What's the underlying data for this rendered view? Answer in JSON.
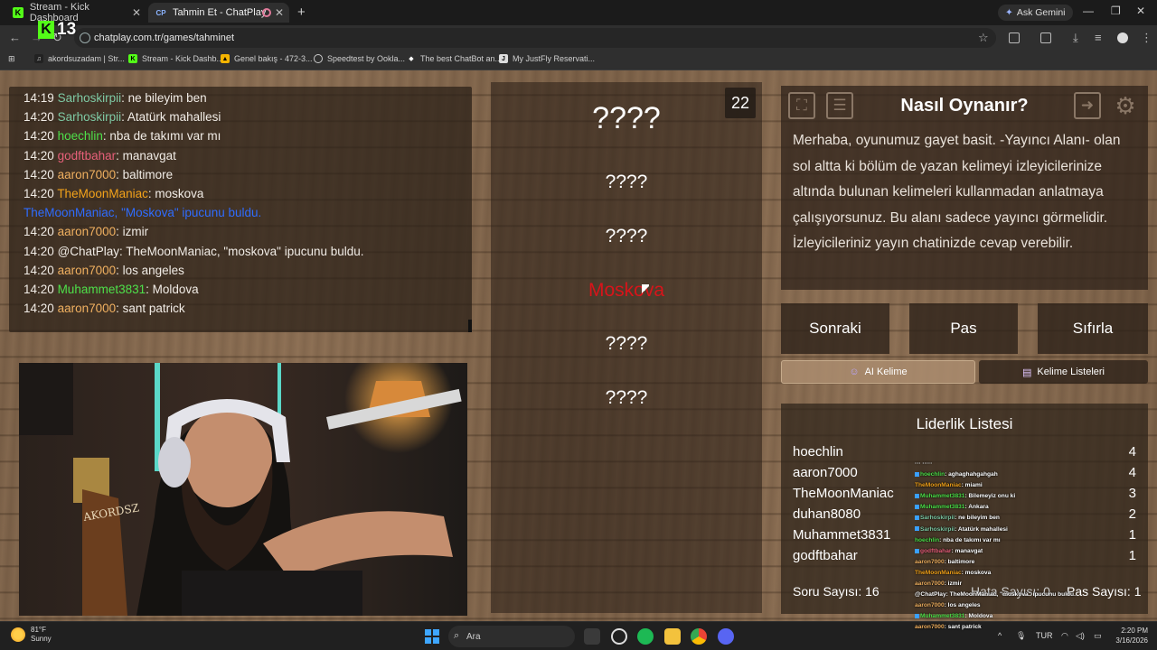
{
  "browser": {
    "tabs": [
      {
        "label": "Stream - Kick Dashboard",
        "active": false
      },
      {
        "label": "Tahmin Et - ChatPlay",
        "active": true
      }
    ],
    "ask_gemini": "Ask Gemini",
    "url": "chatplay.com.tr/games/tahminet",
    "bookmarks": [
      "akordsuzadam | Str...",
      "Stream - Kick Dashb...",
      "Genel bakış - 472-3...",
      "Speedtest by Ookla...",
      "The best ChatBot an...",
      "My JustFly Reservati..."
    ],
    "kick_badge": "13"
  },
  "chat": [
    {
      "time": "14:19",
      "user": "Sarhoskirpii",
      "color": "#7ec9a4",
      "msg": ": ne bileyim ben"
    },
    {
      "time": "14:20",
      "user": "Sarhoskirpii",
      "color": "#7ec9a4",
      "msg": ": Atatürk mahallesi"
    },
    {
      "time": "14:20",
      "user": "hoechlin",
      "color": "#4ee04a",
      "msg": ": nba de takımı var mı"
    },
    {
      "time": "14:20",
      "user": "godftbahar",
      "color": "#e7607a",
      "msg": ": manavgat"
    },
    {
      "time": "14:20",
      "user": "aaron7000",
      "color": "#f0b060",
      "msg": ": baltimore"
    },
    {
      "time": "14:20",
      "user": "TheMoonManiac",
      "color": "#f2a21a",
      "msg": ": moskova"
    },
    {
      "time": "",
      "user": "TheMoonManiac,",
      "color": "#2f6cff",
      "msg": " \"Moskova\" ipucunu buldu.",
      "system": true
    },
    {
      "time": "14:20",
      "user": "aaron7000",
      "color": "#f0b060",
      "msg": ": izmir"
    },
    {
      "time": "14:20",
      "user": "@ChatPlay",
      "color": "#f1ece6",
      "msg": ": TheMoonManiac, \"moskova\" ipucunu buldu."
    },
    {
      "time": "14:20",
      "user": "aaron7000",
      "color": "#f0b060",
      "msg": ": los angeles"
    },
    {
      "time": "14:20",
      "user": "Muhammet3831",
      "color": "#4ee04a",
      "msg": ": Moldova"
    },
    {
      "time": "14:20",
      "user": "aaron7000",
      "color": "#f0b060",
      "msg": ": sant patrick"
    }
  ],
  "game": {
    "counter": "22",
    "words": [
      {
        "text": "????",
        "revealed": false
      },
      {
        "text": "????",
        "revealed": false
      },
      {
        "text": "????",
        "revealed": false
      },
      {
        "text": "Moskova",
        "revealed": true
      },
      {
        "text": "????",
        "revealed": false
      },
      {
        "text": "????",
        "revealed": false
      }
    ]
  },
  "howto": {
    "title": "Nasıl Oynanır?",
    "text": "Merhaba, oyunumuz gayet basit. -Yayıncı Alanı- olan sol altta ki bölüm de yazan kelimeyi izleyicilerinize altında bulunan kelimeleri kullanmadan anlatmaya çalışıyorsunuz. Bu alanı sadece yayıncı görmelidir. İzleyicileriniz yayın chatinizde cevap verebilir."
  },
  "controls": {
    "next": "Sonraki",
    "pass": "Pas",
    "reset": "Sıfırla",
    "ai_word": "AI Kelime",
    "word_lists": "Kelime Listeleri"
  },
  "leaderboard": {
    "title": "Liderlik Listesi",
    "rows": [
      {
        "name": "hoechlin",
        "score": "4"
      },
      {
        "name": "aaron7000",
        "score": "4"
      },
      {
        "name": "TheMoonManiac",
        "score": "3"
      },
      {
        "name": "duhan8080",
        "score": "2"
      },
      {
        "name": "Muhammet3831",
        "score": "1"
      },
      {
        "name": "godftbahar",
        "score": "1"
      }
    ],
    "question_count": "Soru Sayısı: 16",
    "error_count": "Hata Sayısı: 0",
    "pass_count": "Pas Sayısı: 1"
  },
  "stream_overlay": [
    {
      "user": "",
      "msg": "··· ·····",
      "color": "#f0b060"
    },
    {
      "user": "hoechlin",
      "msg": ": aghaghahgahgah",
      "color": "#4ee04a",
      "badge": true
    },
    {
      "user": "TheMoonManiac",
      "msg": ": miami",
      "color": "#f2a21a"
    },
    {
      "user": "Muhammet3831",
      "msg": ": Bilemeyiz onu ki",
      "color": "#4ee04a",
      "badge": true
    },
    {
      "user": "Muhammet3831",
      "msg": ": Ankara",
      "color": "#4ee04a",
      "badge": true
    },
    {
      "user": "Sarhoskirpii",
      "msg": ": ne bileyim ben",
      "color": "#7ec9a4",
      "badge": true
    },
    {
      "user": "Sarhoskirpii",
      "msg": ": Atatürk mahallesi",
      "color": "#7ec9a4",
      "badge": true
    },
    {
      "user": "hoechlin",
      "msg": ": nba de takımı var mı",
      "color": "#4ee04a"
    },
    {
      "user": "godftbahar",
      "msg": ": manavgat",
      "color": "#e7607a",
      "badge": true
    },
    {
      "user": "aaron7000",
      "msg": ": baltimore",
      "color": "#f0b060"
    },
    {
      "user": "TheMoonManiac",
      "msg": ": moskova",
      "color": "#f2a21a"
    },
    {
      "user": "aaron7000",
      "msg": ": izmir",
      "color": "#f0b060"
    },
    {
      "user": "@ChatPlay",
      "msg": ": TheMoonManiac, \"moskova\" ipucunu buldu.",
      "color": "#ffffff"
    },
    {
      "user": "aaron7000",
      "msg": ": los angeles",
      "color": "#f0b060"
    },
    {
      "user": "Muhammet3831",
      "msg": ": Moldova",
      "color": "#4ee04a",
      "badge": true
    },
    {
      "user": "aaron7000",
      "msg": ": sant patrick",
      "color": "#f0b060"
    }
  ],
  "taskbar": {
    "temp": "81°F",
    "weather": "Sunny",
    "search": "Ara",
    "lang": "TUR",
    "time": "2:20 PM",
    "date": "3/16/2026"
  }
}
